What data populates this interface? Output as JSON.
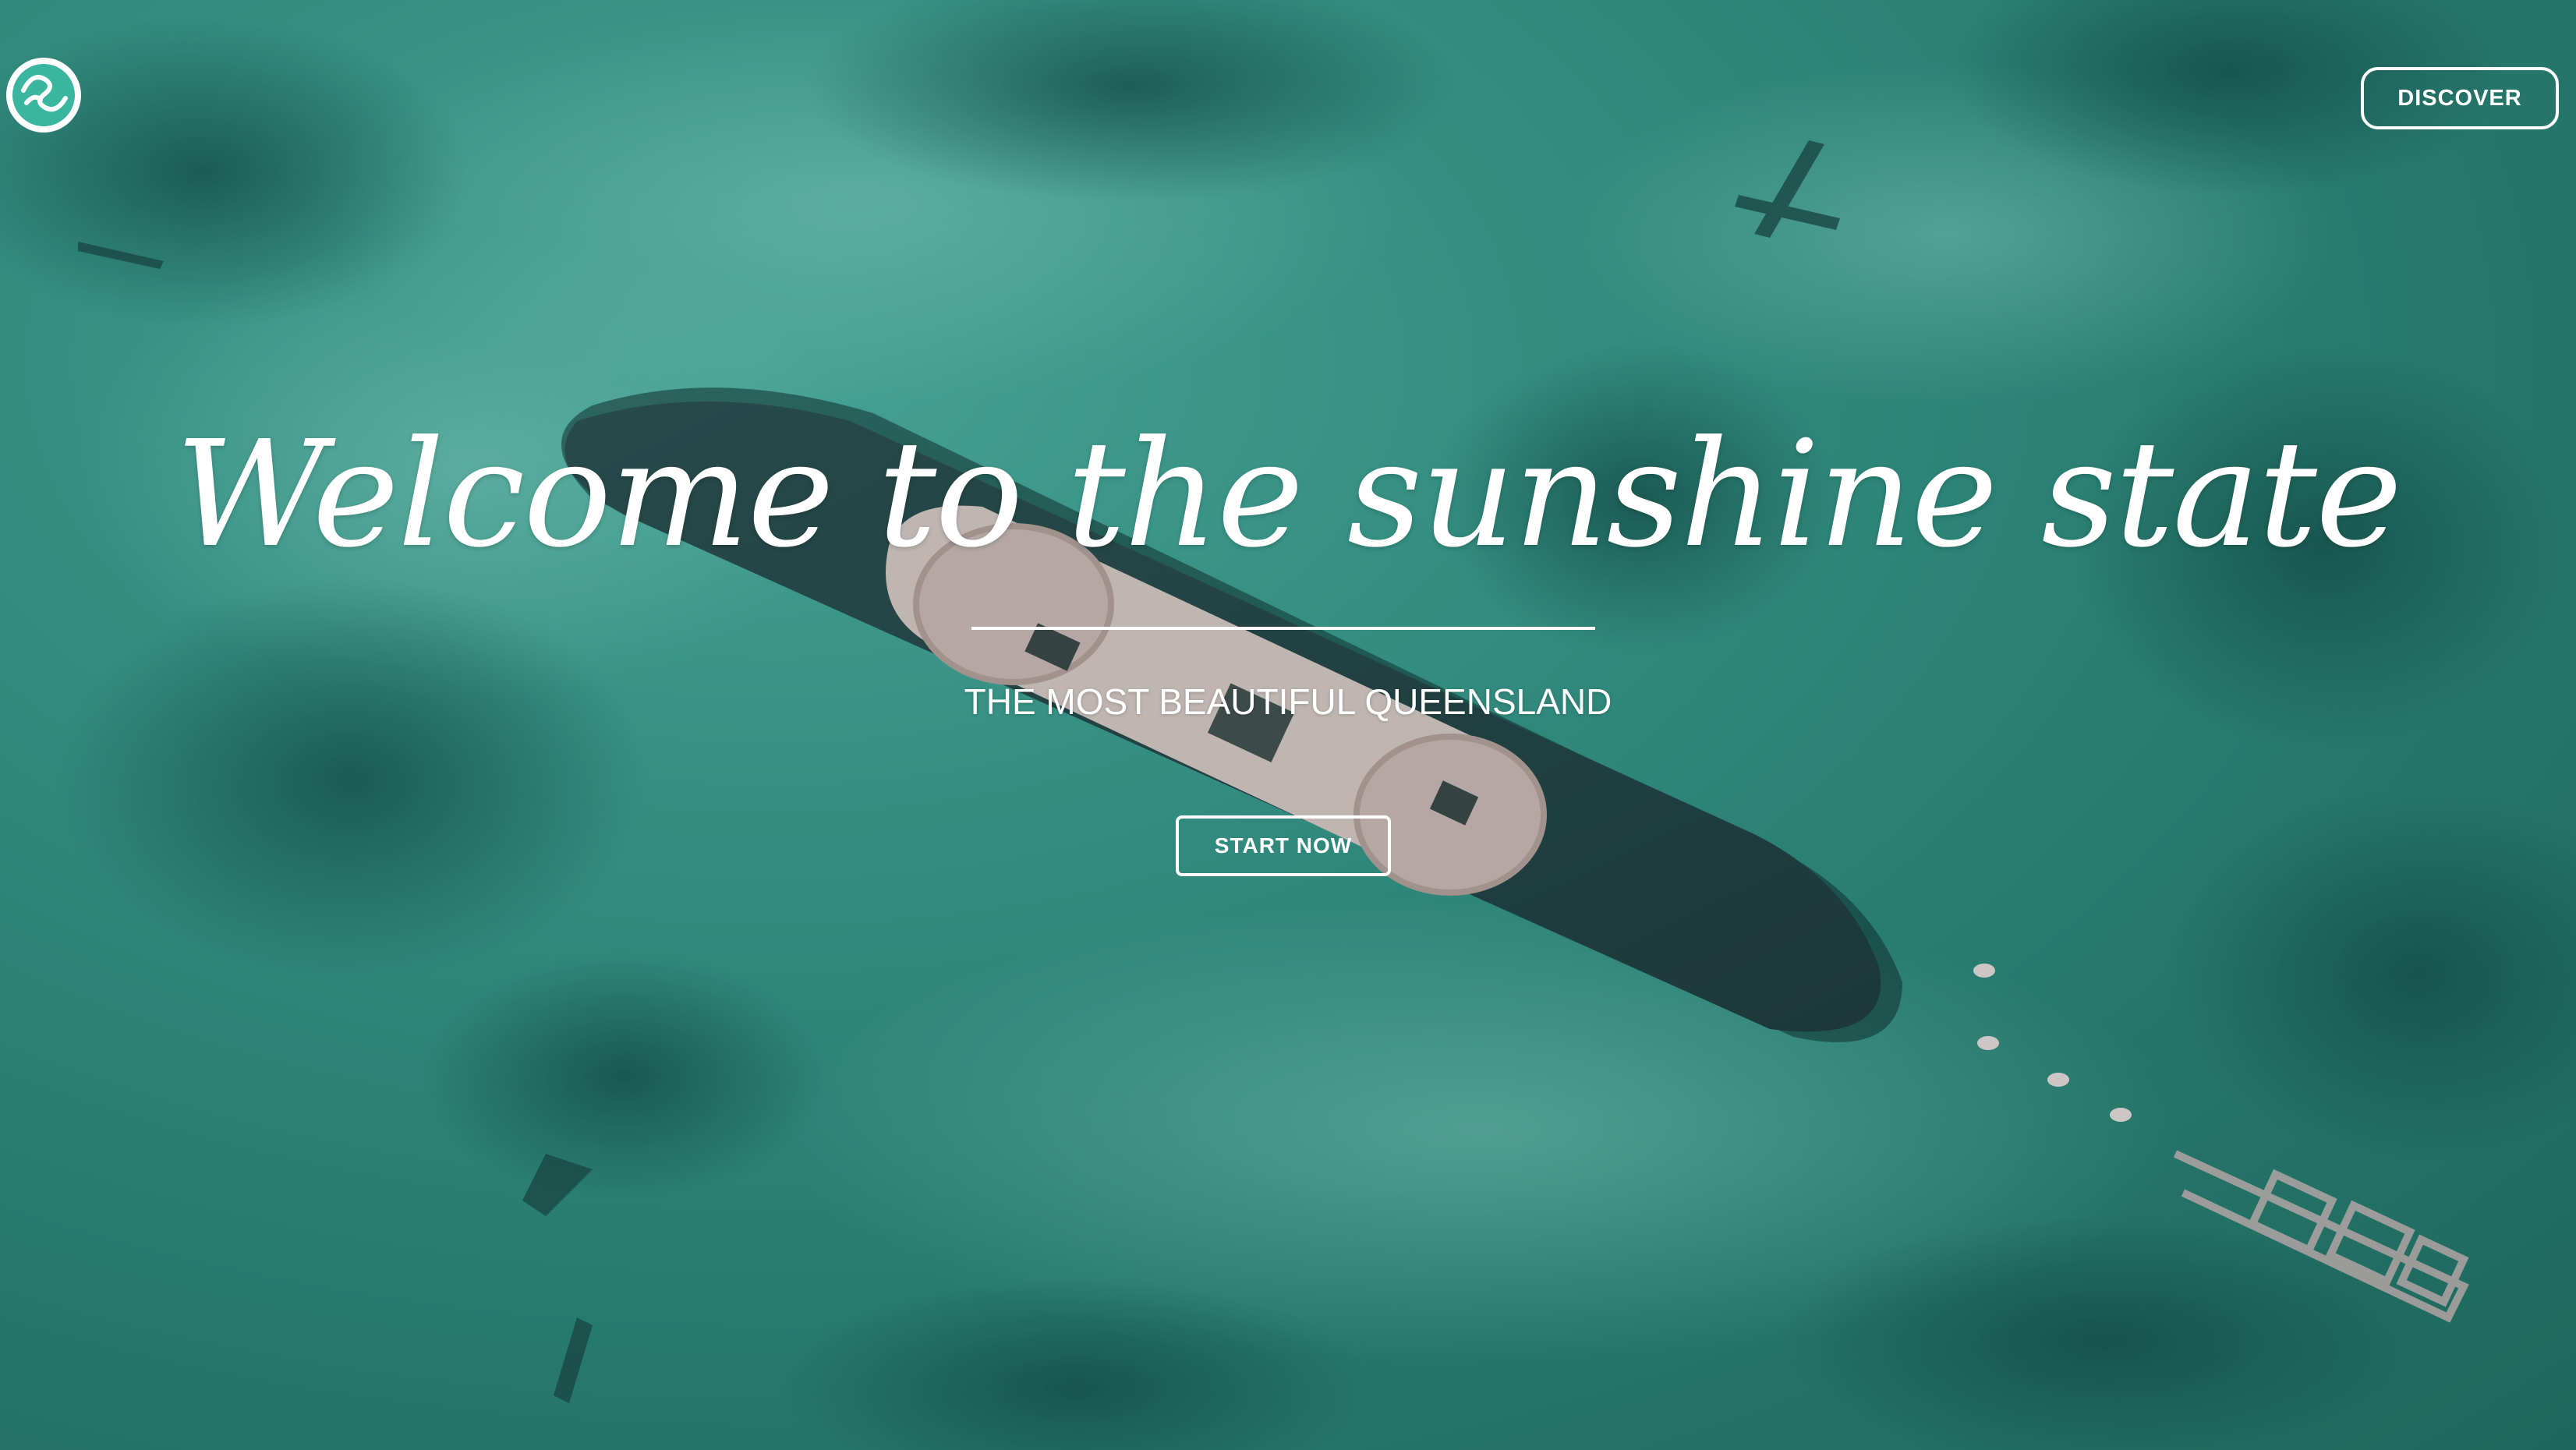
{
  "header": {
    "logo_icon": "wave-logo-icon",
    "discover_label": "DISCOVER"
  },
  "hero": {
    "headline": "Welcome to the sunshine state",
    "subtitle": "THE MOST BEAUTIFUL QUEENSLAND",
    "cta_label": "START NOW",
    "background_image": "aerial view of shipwreck in turquoise water"
  },
  "colors": {
    "accent": "#3ab5a0",
    "text": "#ffffff",
    "water_light": "#4fb3a3",
    "water_dark": "#226f63"
  }
}
